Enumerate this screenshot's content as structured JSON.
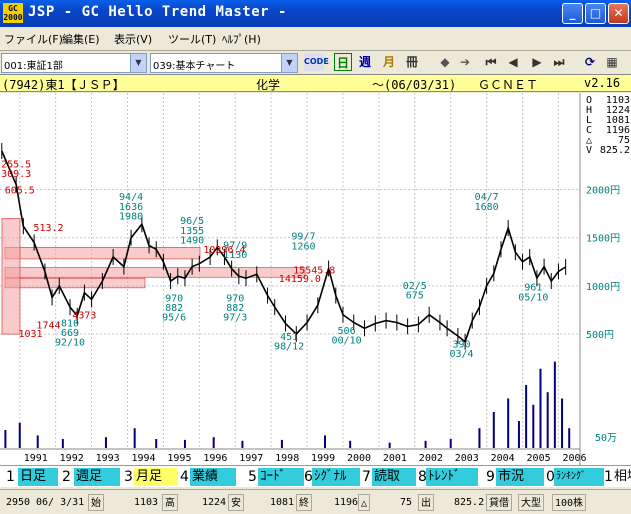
{
  "window": {
    "icon_text": "GC 2000",
    "title": "JSP - GC Hello Trend Master -",
    "minimize": "_",
    "maximize": "□",
    "close": "✕"
  },
  "menu": [
    {
      "label": "ファイル(F)"
    },
    {
      "label": "編集(E)"
    },
    {
      "label": "表示(V)"
    },
    {
      "label": "ツール(T)"
    },
    {
      "label": "ﾍﾙﾌﾟ(H)"
    }
  ],
  "selectors": {
    "market": "001:東証1部",
    "chart": "039:基本チャート"
  },
  "toolbar": {
    "code_label": "CODE",
    "daily": "日",
    "weekly": "週",
    "monthly": "月",
    "book": "冊"
  },
  "info": {
    "code": "(7942)東1【ＪＳＰ】",
    "sector": "化学",
    "date": "～(06/03/31)",
    "source": "ＧＣＮＥＴ",
    "version": "v2.16"
  },
  "ohlc": {
    "O": "1103",
    "H": "1224",
    "L": "1081",
    "C": "1196",
    "delta": "75",
    "V": "825.2",
    "O_label": "O",
    "H_label": "H",
    "L_label": "L",
    "C_label": "C",
    "delta_label": "△",
    "V_label": "V"
  },
  "chart_data": {
    "type": "line",
    "yunit": "円",
    "yticks": [
      {
        "v": 2000,
        "label": "2000円"
      },
      {
        "v": 1500,
        "label": "1500円"
      },
      {
        "v": 1000,
        "label": "1000円"
      },
      {
        "v": 500,
        "label": "500円"
      }
    ],
    "xticks": [
      "1991",
      "1992",
      "1993",
      "1994",
      "1995",
      "1996",
      "1997",
      "1998",
      "1999",
      "2000",
      "2001",
      "2002",
      "2003",
      "2004",
      "2005",
      "2006"
    ],
    "volume_label": "50万",
    "price": [
      [
        1990.5,
        2400
      ],
      [
        1990.9,
        2050
      ],
      [
        1991.1,
        1620
      ],
      [
        1991.4,
        1450
      ],
      [
        1991.7,
        1150
      ],
      [
        1991.9,
        880
      ],
      [
        1992.1,
        1000
      ],
      [
        1992.4,
        780
      ],
      [
        1992.6,
        690
      ],
      [
        1992.8,
        930
      ],
      [
        1993.0,
        860
      ],
      [
        1993.3,
        1050
      ],
      [
        1993.6,
        1300
      ],
      [
        1993.9,
        1200
      ],
      [
        1994.1,
        1500
      ],
      [
        1994.4,
        1640
      ],
      [
        1994.6,
        1420
      ],
      [
        1994.8,
        1380
      ],
      [
        1995.0,
        1250
      ],
      [
        1995.2,
        1050
      ],
      [
        1995.4,
        1100
      ],
      [
        1995.6,
        1080
      ],
      [
        1995.8,
        1200
      ],
      [
        1996.0,
        1230
      ],
      [
        1996.3,
        1300
      ],
      [
        1996.5,
        1400
      ],
      [
        1996.7,
        1300
      ],
      [
        1996.9,
        1180
      ],
      [
        1997.1,
        1100
      ],
      [
        1997.3,
        1080
      ],
      [
        1997.6,
        1120
      ],
      [
        1997.9,
        900
      ],
      [
        1998.1,
        780
      ],
      [
        1998.4,
        610
      ],
      [
        1998.7,
        500
      ],
      [
        1999.0,
        620
      ],
      [
        1999.3,
        800
      ],
      [
        1999.6,
        1180
      ],
      [
        1999.8,
        900
      ],
      [
        2000.0,
        700
      ],
      [
        2000.3,
        620
      ],
      [
        2000.6,
        560
      ],
      [
        2000.9,
        610
      ],
      [
        2001.2,
        640
      ],
      [
        2001.5,
        620
      ],
      [
        2001.8,
        580
      ],
      [
        2002.1,
        600
      ],
      [
        2002.4,
        700
      ],
      [
        2002.7,
        620
      ],
      [
        2002.9,
        560
      ],
      [
        2003.2,
        480
      ],
      [
        2003.4,
        420
      ],
      [
        2003.6,
        640
      ],
      [
        2003.8,
        780
      ],
      [
        2004.0,
        1000
      ],
      [
        2004.2,
        1130
      ],
      [
        2004.4,
        1380
      ],
      [
        2004.6,
        1600
      ],
      [
        2004.8,
        1350
      ],
      [
        2005.0,
        1250
      ],
      [
        2005.2,
        1300
      ],
      [
        2005.4,
        1080
      ],
      [
        2005.6,
        1200
      ],
      [
        2005.8,
        1050
      ],
      [
        2006.0,
        1150
      ],
      [
        2006.2,
        1196
      ]
    ],
    "annotations": [
      {
        "text": "94/4",
        "x": 1994.1,
        "y": 1890,
        "color": "#008080"
      },
      {
        "text": "1636",
        "x": 1994.1,
        "y": 1790,
        "color": "#008080"
      },
      {
        "text": "1980",
        "x": 1994.1,
        "y": 1690,
        "color": "#008080"
      },
      {
        "text": "96/5",
        "x": 1995.8,
        "y": 1640,
        "color": "#008080"
      },
      {
        "text": "1355",
        "x": 1995.8,
        "y": 1540,
        "color": "#008080"
      },
      {
        "text": "1490",
        "x": 1995.8,
        "y": 1440,
        "color": "#008080"
      },
      {
        "text": "97/9",
        "x": 1997.0,
        "y": 1390,
        "color": "#008080"
      },
      {
        "text": "1130",
        "x": 1997.0,
        "y": 1290,
        "color": "#008080"
      },
      {
        "text": "99/7",
        "x": 1998.9,
        "y": 1480,
        "color": "#008080"
      },
      {
        "text": "1260",
        "x": 1998.9,
        "y": 1380,
        "color": "#008080"
      },
      {
        "text": "04/7",
        "x": 2004.0,
        "y": 1890,
        "color": "#008080"
      },
      {
        "text": "1680",
        "x": 2004.0,
        "y": 1790,
        "color": "#008080"
      },
      {
        "text": "970",
        "x": 1995.3,
        "y": 840,
        "color": "#008080"
      },
      {
        "text": "882",
        "x": 1995.3,
        "y": 740,
        "color": "#008080"
      },
      {
        "text": "95/6",
        "x": 1995.3,
        "y": 640,
        "color": "#008080"
      },
      {
        "text": "970",
        "x": 1997.0,
        "y": 840,
        "color": "#008080"
      },
      {
        "text": "882",
        "x": 1997.0,
        "y": 740,
        "color": "#008080"
      },
      {
        "text": "97/3",
        "x": 1997.0,
        "y": 640,
        "color": "#008080"
      },
      {
        "text": "451",
        "x": 1998.5,
        "y": 440,
        "color": "#008080"
      },
      {
        "text": "98/12",
        "x": 1998.5,
        "y": 340,
        "color": "#008080"
      },
      {
        "text": "506",
        "x": 2000.1,
        "y": 500,
        "color": "#008080"
      },
      {
        "text": "00/10",
        "x": 2000.1,
        "y": 400,
        "color": "#008080"
      },
      {
        "text": "02/5",
        "x": 2002.0,
        "y": 970,
        "color": "#008080"
      },
      {
        "text": "675",
        "x": 2002.0,
        "y": 870,
        "color": "#008080"
      },
      {
        "text": "390",
        "x": 2003.3,
        "y": 360,
        "color": "#008080"
      },
      {
        "text": "03/4",
        "x": 2003.3,
        "y": 260,
        "color": "#008080"
      },
      {
        "text": "961",
        "x": 2005.3,
        "y": 950,
        "color": "#008080"
      },
      {
        "text": "05/10",
        "x": 2005.3,
        "y": 850,
        "color": "#008080"
      },
      {
        "text": "669",
        "x": 1992.4,
        "y": 480,
        "color": "#008080"
      },
      {
        "text": "92/10",
        "x": 1992.4,
        "y": 380,
        "color": "#008080"
      },
      {
        "text": "810",
        "x": 1992.4,
        "y": 580,
        "color": "#008080"
      },
      {
        "text": "255.5",
        "x": 1990.9,
        "y": 2230,
        "color": "#cc0000"
      },
      {
        "text": "309.3",
        "x": 1990.9,
        "y": 2130,
        "color": "#cc0000"
      },
      {
        "text": "605.5",
        "x": 1991.0,
        "y": 1960,
        "color": "#cc0000"
      },
      {
        "text": "513.2",
        "x": 1991.8,
        "y": 1570,
        "color": "#cc0000"
      },
      {
        "text": "10396.4",
        "x": 1996.7,
        "y": 1340,
        "color": "#cc0000"
      },
      {
        "text": "15545.8",
        "x": 1999.2,
        "y": 1130,
        "color": "#cc0000"
      },
      {
        "text": "14159.0",
        "x": 1998.8,
        "y": 1040,
        "color": "#cc0000"
      },
      {
        "text": "4373",
        "x": 1992.8,
        "y": 660,
        "color": "#cc0000"
      },
      {
        "text": "1744",
        "x": 1991.8,
        "y": 560,
        "color": "#cc0000"
      },
      {
        "text": "1031",
        "x": 1991.3,
        "y": 470,
        "color": "#cc0000"
      }
    ]
  },
  "fkeys": [
    {
      "num": "1",
      "label": "日足"
    },
    {
      "num": "2",
      "label": "週足"
    },
    {
      "num": "3",
      "label": "月足"
    },
    {
      "num": "4",
      "label": "業績"
    },
    {
      "num": "5",
      "label": "ｺｰﾄﾞ"
    },
    {
      "num": "6",
      "label": "ｼｸﾞﾅﾙ"
    },
    {
      "num": "7",
      "label": "読取"
    },
    {
      "num": "8",
      "label": "ﾄﾚﾝﾄﾞ"
    },
    {
      "num": "9",
      "label": "市況"
    },
    {
      "num": "0",
      "label": "ﾗﾝｷﾝｸﾞ"
    },
    {
      "num": "1",
      "label": "相場"
    }
  ],
  "status": {
    "code": "2950",
    "date": "06/ 3/31",
    "open_label": "始",
    "open": "1103",
    "high_label": "高",
    "high": "1224",
    "low_label": "安",
    "low": "1081",
    "close_label": "終",
    "close": "1196",
    "delta_label": "△",
    "delta": "75",
    "vol_label": "出",
    "vol": "825.2",
    "margin": "貸借",
    "size": "大型",
    "unit": "100株"
  },
  "colors": {
    "info_bg": "#ffff99",
    "price_line": "#000000",
    "annot_teal": "#008080",
    "annot_red": "#cc0000",
    "fkey_cyan": "#33ccdd",
    "fkey_yellow": "#ffff66"
  }
}
